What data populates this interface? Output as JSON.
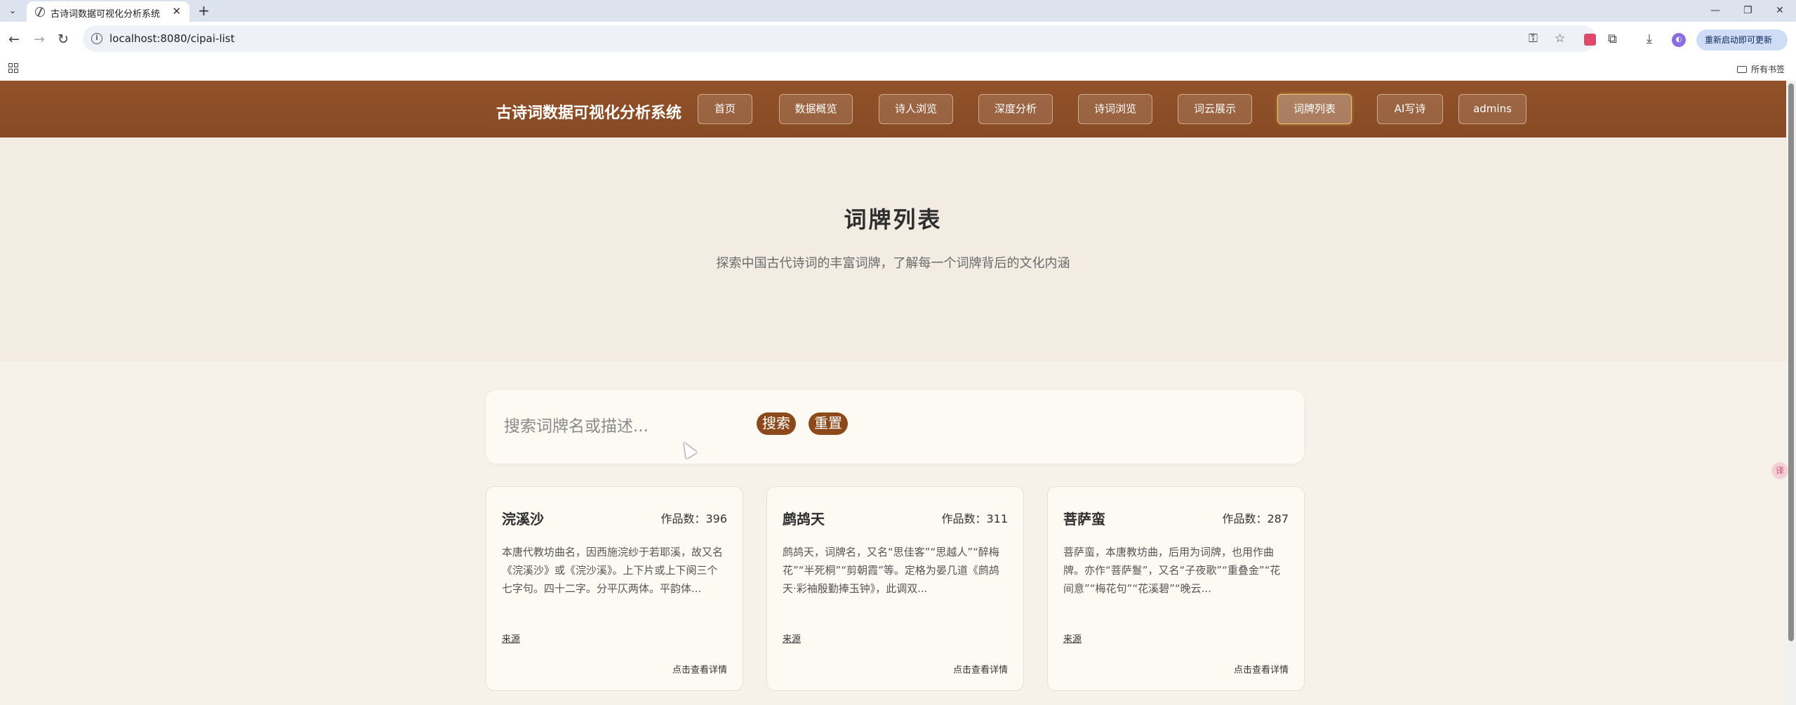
{
  "browser": {
    "tab_title": "古诗词数据可视化分析系统",
    "url": "localhost:8080/cipai-list",
    "update_button": "重新启动即可更新",
    "bookmarks_all": "所有书签"
  },
  "header": {
    "logo": "古诗词数据可视化分析系统",
    "nav": [
      {
        "label": "首页"
      },
      {
        "label": "数据概览"
      },
      {
        "label": "诗人浏览"
      },
      {
        "label": "深度分析"
      },
      {
        "label": "诗词浏览"
      },
      {
        "label": "词云展示"
      },
      {
        "label": "词牌列表",
        "active": true
      },
      {
        "label": "AI写诗"
      },
      {
        "label": "admins"
      }
    ]
  },
  "hero": {
    "title": "词牌列表",
    "subtitle": "探索中国古代诗词的丰富词牌，了解每一个词牌背后的文化内涵"
  },
  "search": {
    "placeholder": "搜索词牌名或描述...",
    "search_label": "搜索",
    "reset_label": "重置"
  },
  "cards": [
    {
      "name": "浣溪沙",
      "count_label": "作品数：396",
      "description": "本唐代教坊曲名，因西施浣纱于若耶溪，故又名《浣溪沙》或《浣沙溪》。上下片或上下阕三个七字句。四十二字。分平仄两体。平韵体...",
      "source_label": "来源",
      "more_label": "点击查看详情"
    },
    {
      "name": "鹧鸪天",
      "count_label": "作品数：311",
      "description": "鹧鸪天，词牌名，又名“思佳客”“思越人”“醉梅花”“半死桐”“剪朝霞”等。定格为晏几道《鹧鸪天·彩袖殷勤捧玉钟》，此调双...",
      "source_label": "来源",
      "more_label": "点击查看详情"
    },
    {
      "name": "菩萨蛮",
      "count_label": "作品数：287",
      "description": "菩萨蛮，本唐教坊曲，后用为词牌，也用作曲牌。亦作“菩萨鬘”，又名“子夜歌”“重叠金”“花间意”“梅花句”“花溪碧”“晚云...",
      "source_label": "来源",
      "more_label": "点击查看详情"
    }
  ]
}
